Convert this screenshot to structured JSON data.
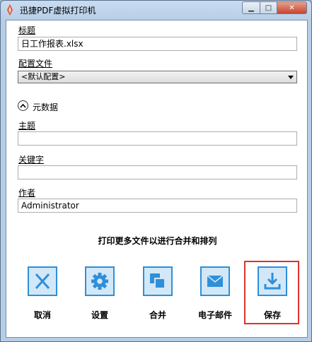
{
  "window": {
    "title": "迅捷PDF虚拟打印机",
    "min_label": "▁",
    "max_label": "□",
    "close_label": "✕"
  },
  "form": {
    "title_label": "标题",
    "title_value": "日工作报表.xlsx",
    "profile_label": "配置文件",
    "profile_value": "<默认配置>",
    "metadata_label": "元数据",
    "subject_label": "主题",
    "subject_value": "",
    "keywords_label": "关键字",
    "keywords_value": "",
    "author_label": "作者",
    "author_value": "Administrator"
  },
  "hint": "打印更多文件以进行合并和排列",
  "actions": {
    "cancel": "取消",
    "settings": "设置",
    "merge": "合并",
    "email": "电子邮件",
    "save": "保存"
  },
  "colors": {
    "icon_fill": "#d2e8f8",
    "icon_stroke": "#2f8fd8",
    "highlight": "#d9342b"
  }
}
